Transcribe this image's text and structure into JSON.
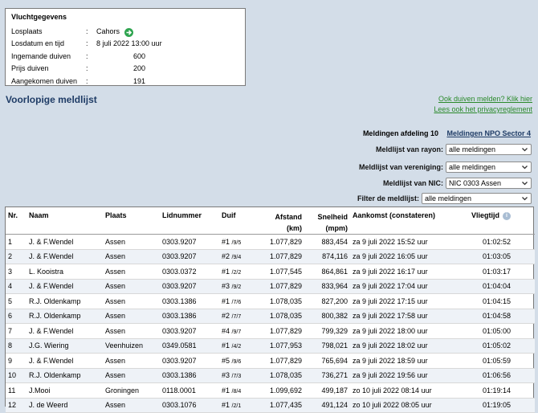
{
  "flight": {
    "heading": "Vluchtgegevens",
    "rows": [
      {
        "label": "Losplaats",
        "value": "Cahors"
      },
      {
        "label": "Losdatum en tijd",
        "value": "8 juli 2022 13:00 uur"
      },
      {
        "label": "Ingemande duiven",
        "value": "600"
      },
      {
        "label": "Prijs duiven",
        "value": "200"
      },
      {
        "label": "Aangekomen duiven",
        "value": "191"
      }
    ],
    "colon": ":"
  },
  "page_title": "Voorlopige meldlijst",
  "links": {
    "report": "Ook duiven melden? Klik hier",
    "privacy": "Lees ook het privacyreglement"
  },
  "afdeling": {
    "current": "Meldingen afdeling 10",
    "sector": "Meldingen NPO Sector 4"
  },
  "filters": {
    "rayon": {
      "label": "Meldlijst van rayon:",
      "value": "alle meldingen"
    },
    "vereniging": {
      "label": "Meldlijst van vereniging:",
      "value": "alle meldingen"
    },
    "nic": {
      "label": "Meldlijst van NIC:",
      "value": "NIC 0303 Assen"
    },
    "meldlijst": {
      "label": "Filter de meldlijst:",
      "value": "alle meldingen"
    }
  },
  "table": {
    "headers": {
      "nr": "Nr.",
      "naam": "Naam",
      "plaats": "Plaats",
      "lidnummer": "Lidnummer",
      "duif": "Duif",
      "afstand": "Afstand",
      "afstand_unit": "(km)",
      "snelheid": "Snelheid",
      "snelheid_unit": "(mpm)",
      "aankomst": "Aankomst (constateren)",
      "vliegtijd": "Vliegtijd"
    },
    "rows": [
      {
        "nr": "1",
        "naam": "J. & F.Wendel",
        "plaats": "Assen",
        "lid": "0303.9207",
        "duif": "#1",
        "duif_sub": "/9/5",
        "afstand": "1.077,829",
        "snelheid": "883,454",
        "aankomst": "za 9 juli 2022 15:52 uur",
        "vliegtijd": "01:02:52"
      },
      {
        "nr": "2",
        "naam": "J. & F.Wendel",
        "plaats": "Assen",
        "lid": "0303.9207",
        "duif": "#2",
        "duif_sub": "/9/4",
        "afstand": "1.077,829",
        "snelheid": "874,116",
        "aankomst": "za 9 juli 2022 16:05 uur",
        "vliegtijd": "01:03:05"
      },
      {
        "nr": "3",
        "naam": "L. Kooistra",
        "plaats": "Assen",
        "lid": "0303.0372",
        "duif": "#1",
        "duif_sub": "/2/2",
        "afstand": "1.077,545",
        "snelheid": "864,861",
        "aankomst": "za 9 juli 2022 16:17 uur",
        "vliegtijd": "01:03:17"
      },
      {
        "nr": "4",
        "naam": "J. & F.Wendel",
        "plaats": "Assen",
        "lid": "0303.9207",
        "duif": "#3",
        "duif_sub": "/9/2",
        "afstand": "1.077,829",
        "snelheid": "833,964",
        "aankomst": "za 9 juli 2022 17:04 uur",
        "vliegtijd": "01:04:04"
      },
      {
        "nr": "5",
        "naam": "R.J. Oldenkamp",
        "plaats": "Assen",
        "lid": "0303.1386",
        "duif": "#1",
        "duif_sub": "/7/6",
        "afstand": "1.078,035",
        "snelheid": "827,200",
        "aankomst": "za 9 juli 2022 17:15 uur",
        "vliegtijd": "01:04:15"
      },
      {
        "nr": "6",
        "naam": "R.J. Oldenkamp",
        "plaats": "Assen",
        "lid": "0303.1386",
        "duif": "#2",
        "duif_sub": "/7/7",
        "afstand": "1.078,035",
        "snelheid": "800,382",
        "aankomst": "za 9 juli 2022 17:58 uur",
        "vliegtijd": "01:04:58"
      },
      {
        "nr": "7",
        "naam": "J. & F.Wendel",
        "plaats": "Assen",
        "lid": "0303.9207",
        "duif": "#4",
        "duif_sub": "/9/7",
        "afstand": "1.077,829",
        "snelheid": "799,329",
        "aankomst": "za 9 juli 2022 18:00 uur",
        "vliegtijd": "01:05:00"
      },
      {
        "nr": "8",
        "naam": "J.G. Wiering",
        "plaats": "Veenhuizen",
        "lid": "0349.0581",
        "duif": "#1",
        "duif_sub": "/4/2",
        "afstand": "1.077,953",
        "snelheid": "798,021",
        "aankomst": "za 9 juli 2022 18:02 uur",
        "vliegtijd": "01:05:02"
      },
      {
        "nr": "9",
        "naam": "J. & F.Wendel",
        "plaats": "Assen",
        "lid": "0303.9207",
        "duif": "#5",
        "duif_sub": "/9/6",
        "afstand": "1.077,829",
        "snelheid": "765,694",
        "aankomst": "za 9 juli 2022 18:59 uur",
        "vliegtijd": "01:05:59"
      },
      {
        "nr": "10",
        "naam": "R.J. Oldenkamp",
        "plaats": "Assen",
        "lid": "0303.1386",
        "duif": "#3",
        "duif_sub": "/7/3",
        "afstand": "1.078,035",
        "snelheid": "736,271",
        "aankomst": "za 9 juli 2022 19:56 uur",
        "vliegtijd": "01:06:56"
      },
      {
        "nr": "11",
        "naam": "J.Mooi",
        "plaats": "Groningen",
        "lid": "0118.0001",
        "duif": "#1",
        "duif_sub": "/8/4",
        "afstand": "1.099,692",
        "snelheid": "499,187",
        "aankomst": "zo 10 juli 2022 08:14 uur",
        "vliegtijd": "01:19:14"
      },
      {
        "nr": "12",
        "naam": "J. de Weerd",
        "plaats": "Assen",
        "lid": "0303.1076",
        "duif": "#1",
        "duif_sub": "/2/1",
        "afstand": "1.077,435",
        "snelheid": "491,124",
        "aankomst": "zo 10 juli 2022 08:05 uur",
        "vliegtijd": "01:19:05"
      }
    ]
  }
}
